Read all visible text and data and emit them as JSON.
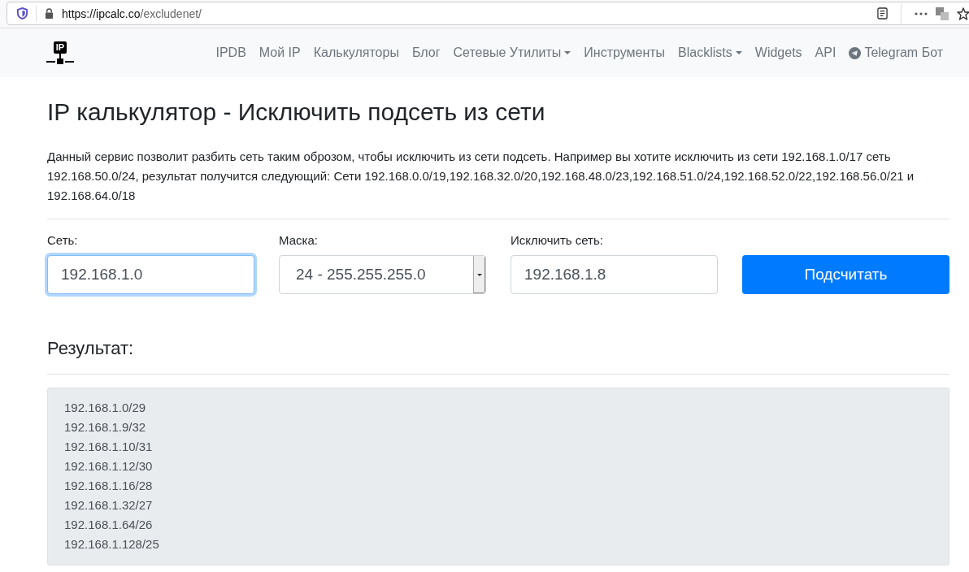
{
  "browser": {
    "url_host": "https://ipcalc.co",
    "url_path": "/excludenet/"
  },
  "navbar": {
    "logo_text": "IP",
    "items": [
      {
        "label": "IPDB",
        "kind": "link"
      },
      {
        "label": "Мой IP",
        "kind": "link"
      },
      {
        "label": "Калькуляторы",
        "kind": "link"
      },
      {
        "label": "Блог",
        "kind": "link"
      },
      {
        "label": "Сетевые Утилиты",
        "kind": "dropdown"
      },
      {
        "label": "Инструменты",
        "kind": "link"
      },
      {
        "label": "Blacklists",
        "kind": "dropdown"
      },
      {
        "label": "Widgets",
        "kind": "link"
      },
      {
        "label": "API",
        "kind": "link"
      },
      {
        "label": "Telegram Бот",
        "kind": "telegram"
      }
    ]
  },
  "title": "IP калькулятор - Исключить подсеть из сети",
  "description": "Данный сервис позволит разбить сеть таким оброзом, чтобы исключить из сети подсеть. Например вы хотите исключить из сети 192.168.1.0/17 сеть 192.168.50.0/24, результат получится следующий: Сети 192.168.0.0/19,192.168.32.0/20,192.168.48.0/23,192.168.51.0/24,192.168.52.0/22,192.168.56.0/21 и 192.168.64.0/18",
  "form": {
    "fields": [
      {
        "label": "Сеть:",
        "kind": "text",
        "value": "192.168.1.0",
        "focused": true
      },
      {
        "label": "Маска:",
        "kind": "select",
        "value": "24 - 255.255.255.0",
        "focused": false
      },
      {
        "label": "Исключить сеть:",
        "kind": "text",
        "value": "192.168.1.8",
        "focused": false
      }
    ],
    "submit": "Подсчитать"
  },
  "result": {
    "heading": "Результат:",
    "lines": [
      "192.168.1.0/29",
      "192.168.1.9/32",
      "192.168.1.10/31",
      "192.168.1.12/30",
      "192.168.1.16/28",
      "192.168.1.32/27",
      "192.168.1.64/26",
      "192.168.1.128/25"
    ]
  }
}
